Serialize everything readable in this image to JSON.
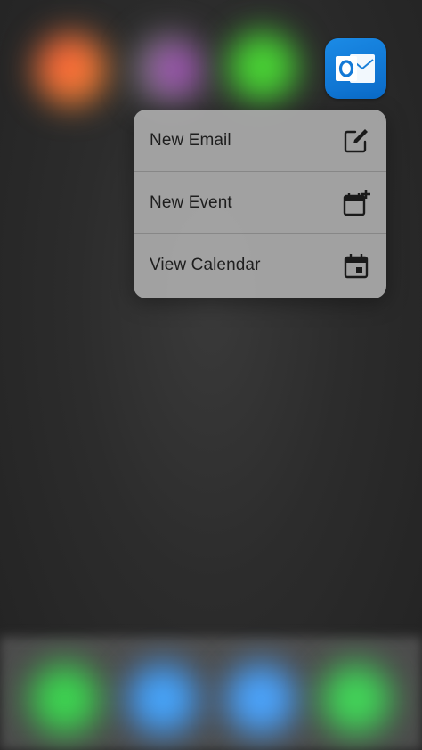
{
  "app": {
    "icon_name": "outlook-icon",
    "brand_color": "#0a6ac8"
  },
  "quick_actions": [
    {
      "label": "New Email",
      "icon": "compose-icon"
    },
    {
      "label": "New Event",
      "icon": "calendar-add-icon"
    },
    {
      "label": "View Calendar",
      "icon": "calendar-icon"
    }
  ],
  "background_icon_colors": [
    "#f06a3a",
    "#9a4bd0",
    "#4fd63b",
    "#3adf4a",
    "#3a8df5",
    "#3aa0f5",
    "#3adf4a"
  ]
}
